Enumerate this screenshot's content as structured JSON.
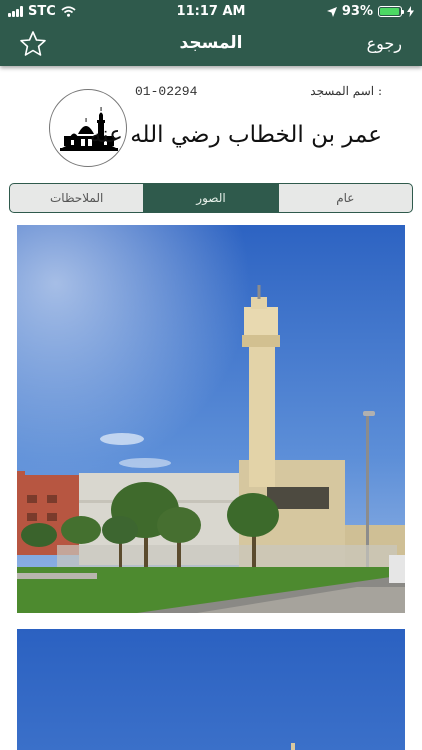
{
  "status_bar": {
    "carrier": "STC",
    "time": "11:17 AM",
    "battery": "93%",
    "battery_level": 0.93
  },
  "nav": {
    "title": "المسجد",
    "back_label": "رجوع",
    "favorite_icon": "star-outline-icon"
  },
  "mosque": {
    "name_label": "اسم المسجد :",
    "code": "01-02294",
    "name": "عمر بن الخطاب رضي الله عنه",
    "logo_icon": "mosque-icon"
  },
  "tabs": [
    {
      "label": "الملاحظات",
      "active": false
    },
    {
      "label": "الصور",
      "active": true
    },
    {
      "label": "عام",
      "active": false
    }
  ],
  "colors": {
    "primary": "#2f5a4c",
    "tab_inactive": "#e7e8e7",
    "sky": "#3f72c9",
    "grass": "#4a8a2e"
  }
}
